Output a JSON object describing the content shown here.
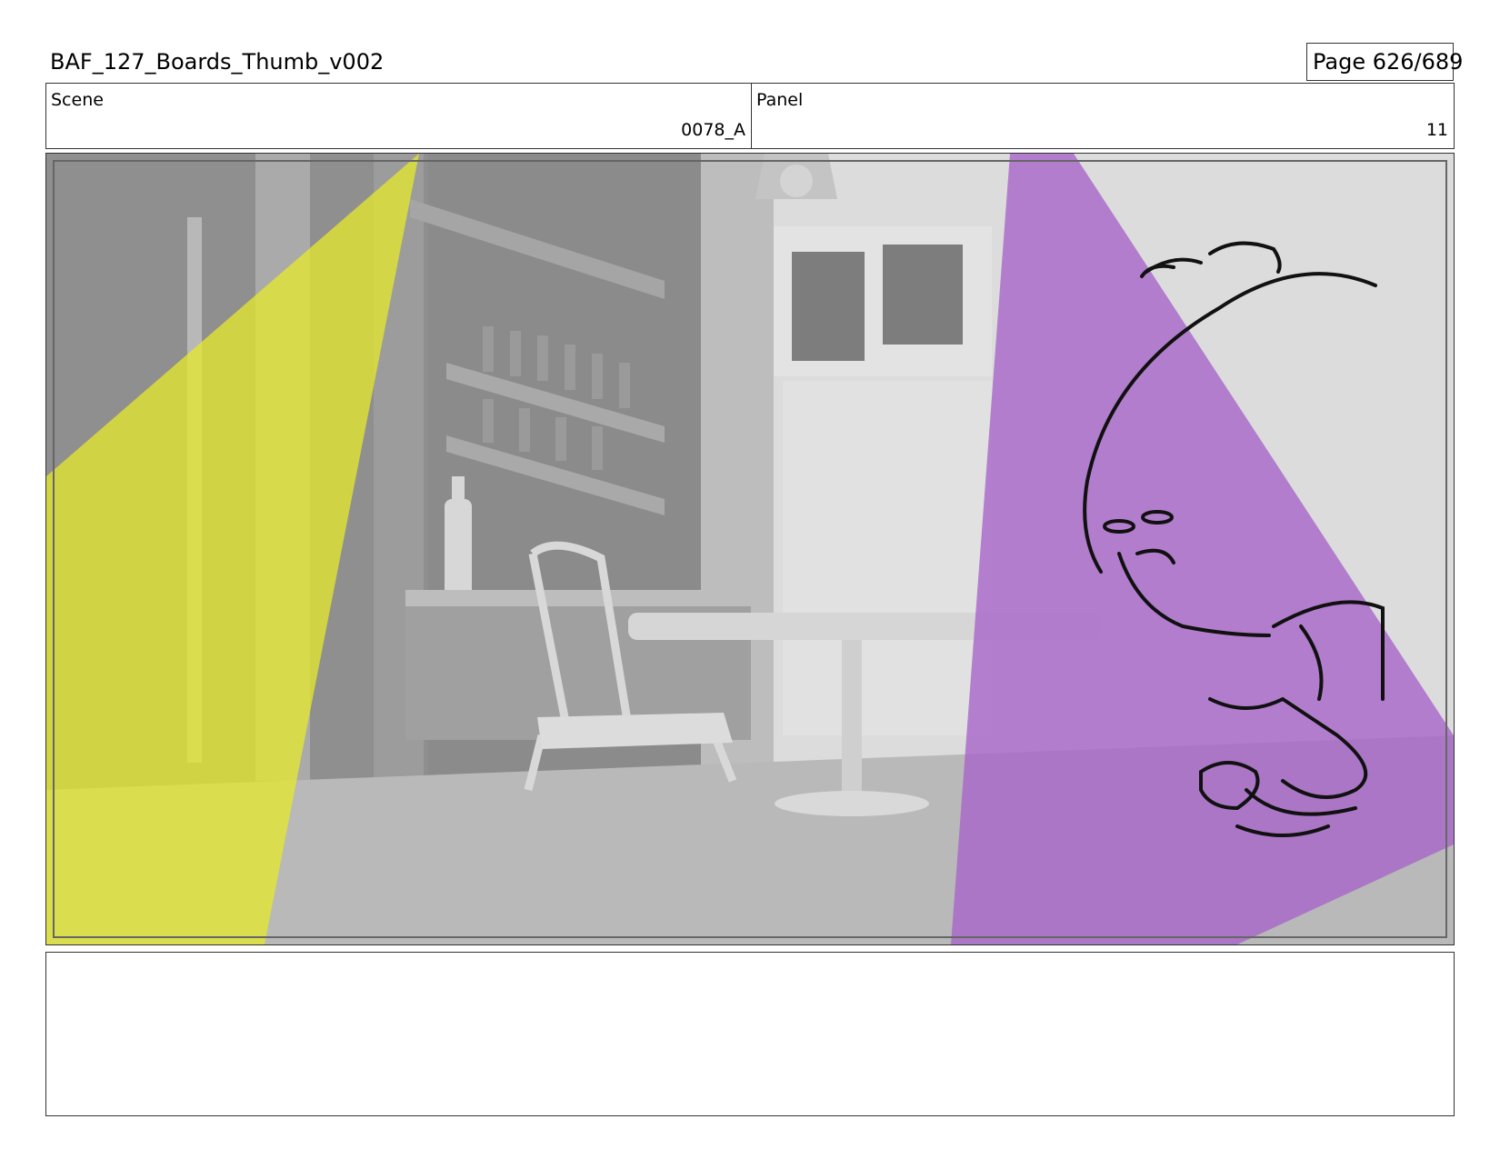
{
  "document": {
    "title": "BAF_127_Boards_Thumb_v002",
    "page_label": "Page 626/689"
  },
  "header": {
    "scene_label": "Scene",
    "scene_value": "0078_A",
    "panel_label": "Panel",
    "panel_value": "11"
  },
  "notes": {
    "text": ""
  },
  "colors": {
    "yellow_light": "#e5ea2a",
    "purple_light": "#a865c9",
    "line_art": "#111111"
  }
}
